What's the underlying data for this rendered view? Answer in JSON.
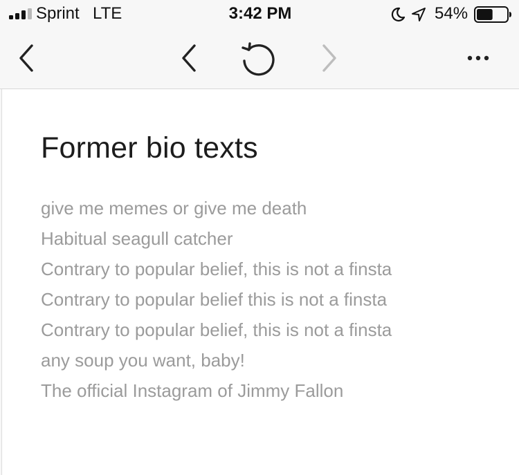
{
  "status_bar": {
    "carrier": "Sprint",
    "network": "LTE",
    "time": "3:42 PM",
    "battery_percent": "54%",
    "battery_level": 0.54,
    "signal_bars": 3,
    "signal_bars_total": 4,
    "icons": [
      "signal-icon",
      "moon-icon",
      "location-icon",
      "battery-icon"
    ]
  },
  "toolbar": {
    "icons": [
      "close-chevron-icon",
      "back-chevron-icon",
      "reload-icon",
      "forward-chevron-icon",
      "more-icon"
    ]
  },
  "page": {
    "title": "Former bio texts",
    "bios": [
      "give me memes or give me death",
      "Habitual seagull catcher",
      "Contrary to popular belief, this is not a finsta",
      "Contrary to popular belief this is not a finsta",
      "Contrary to popular belief, this is not a finsta",
      "any soup you want, baby!",
      "The official Instagram of Jimmy Fallon"
    ]
  },
  "colors": {
    "title_text": "#1c1c1c",
    "bio_text": "#9b9b9b",
    "toolbar_bg": "#f7f7f7",
    "disabled_icon": "#bdbdbd",
    "content_bg": "#ffffff"
  }
}
